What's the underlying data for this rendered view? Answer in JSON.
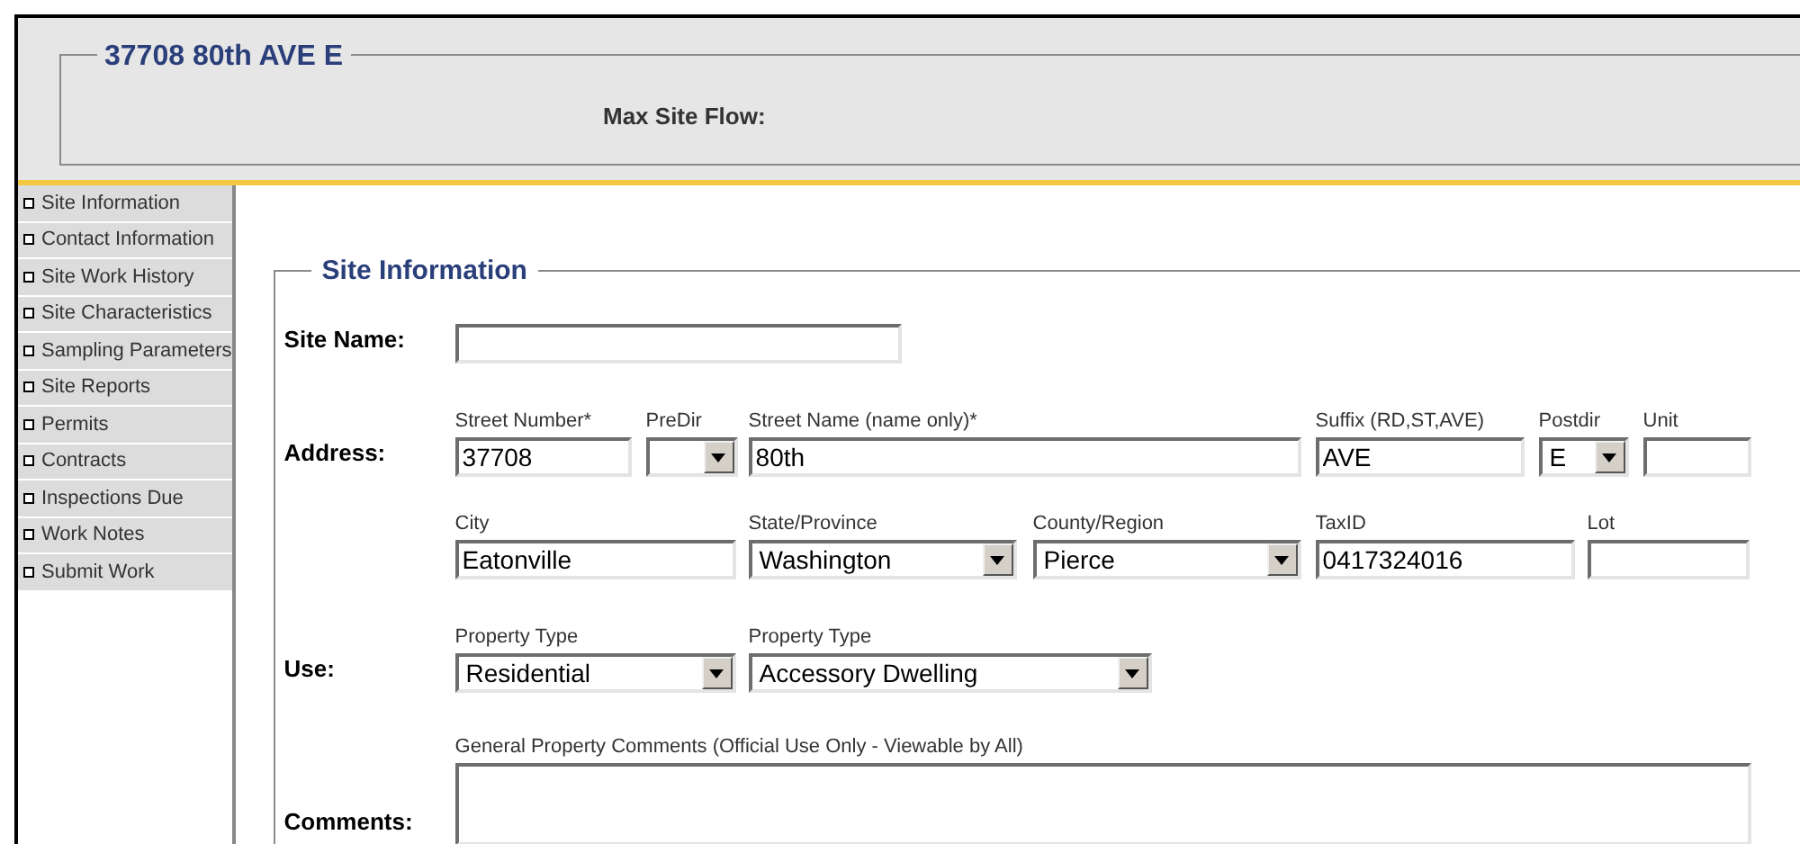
{
  "header": {
    "title": "37708 80th AVE E",
    "max_site_flow_label": "Max Site Flow:"
  },
  "sidebar": {
    "items": [
      {
        "label": "Site Information"
      },
      {
        "label": "Contact Information"
      },
      {
        "label": "Site Work History"
      },
      {
        "label": "Site Characteristics"
      },
      {
        "label": "Sampling Parameters"
      },
      {
        "label": "Site Reports"
      },
      {
        "label": "Permits"
      },
      {
        "label": "Contracts"
      },
      {
        "label": "Inspections Due"
      },
      {
        "label": "Work Notes"
      },
      {
        "label": "Submit Work"
      }
    ]
  },
  "form": {
    "legend": "Site Information",
    "rows": [
      {
        "label": "Site Name:",
        "fields": [
          {
            "kind": "text"
          }
        ]
      },
      {
        "label": "Address:",
        "fields": [
          {
            "kind": "text",
            "caption": "Street Number*",
            "value": "37708"
          },
          {
            "kind": "select",
            "caption": "PreDir"
          },
          {
            "kind": "text",
            "caption": "Street Name (name only)*",
            "value": "80th"
          },
          {
            "kind": "text",
            "caption": "Suffix (RD,ST,AVE)",
            "value": "AVE"
          },
          {
            "kind": "select",
            "caption": "Postdir",
            "value": "E"
          },
          {
            "kind": "text",
            "caption": "Unit"
          }
        ]
      },
      {
        "fields": [
          {
            "kind": "text",
            "caption": "City",
            "value": "Eatonville"
          },
          {
            "kind": "select",
            "caption": "State/Province",
            "value": "Washington"
          },
          {
            "kind": "select",
            "caption": "County/Region",
            "value": "Pierce"
          },
          {
            "kind": "text",
            "caption": "TaxID",
            "value": "0417324016"
          },
          {
            "kind": "text",
            "caption": "Lot"
          }
        ]
      },
      {
        "label": "Use:",
        "fields": [
          {
            "kind": "select",
            "caption": "Property Type",
            "value": "Residential"
          },
          {
            "kind": "select",
            "caption": "Property Type",
            "value": "Accessory Dwelling"
          }
        ]
      },
      {
        "label": "Comments:",
        "fields": [
          {
            "kind": "textarea",
            "caption": "General Property Comments (Official Use Only - Viewable by All)"
          }
        ]
      }
    ]
  }
}
